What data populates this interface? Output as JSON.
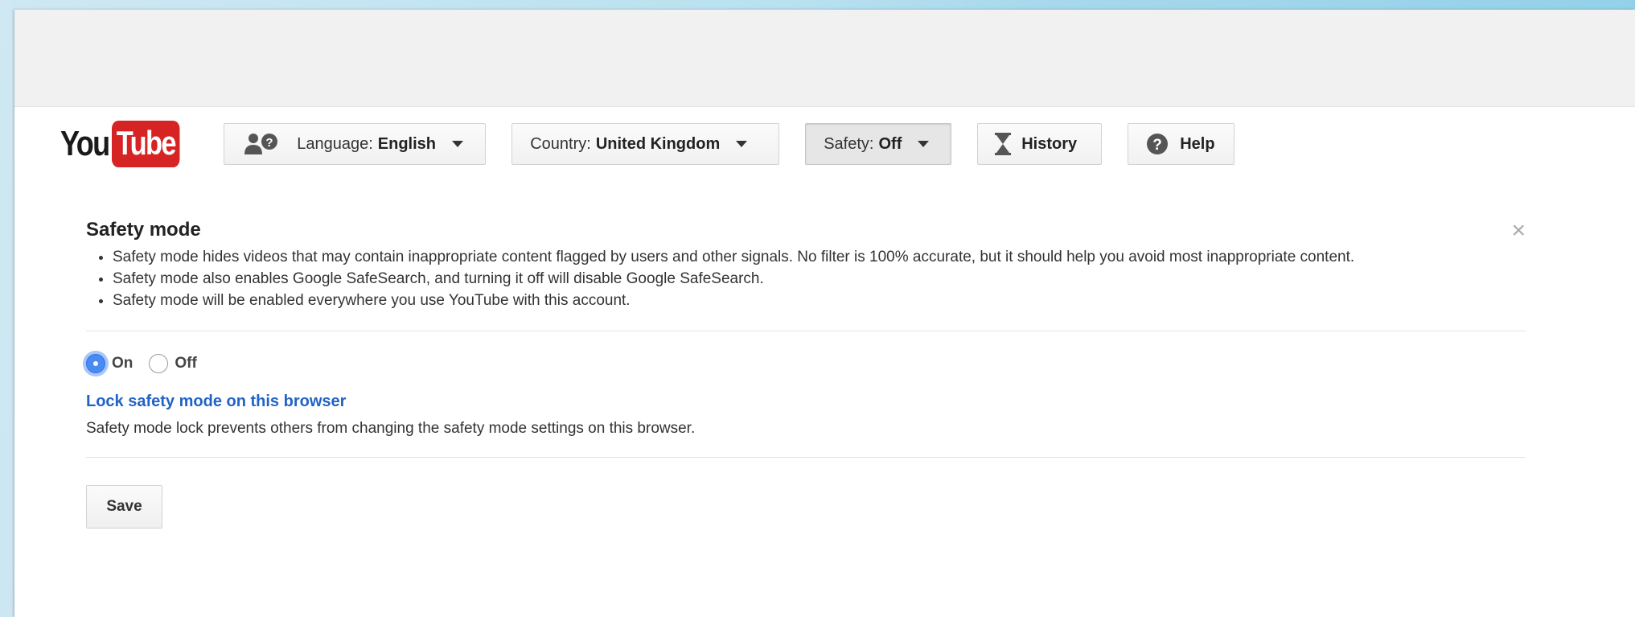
{
  "logo": {
    "you": "You",
    "tube": "Tube"
  },
  "toolbar": {
    "language": {
      "label": "Language:",
      "value": "English"
    },
    "country": {
      "label": "Country:",
      "value": "United Kingdom"
    },
    "safety": {
      "label": "Safety:",
      "value": "Off"
    },
    "history": {
      "label": "History"
    },
    "help": {
      "label": "Help"
    }
  },
  "panel": {
    "title": "Safety mode",
    "close": "×",
    "bullets": [
      "Safety mode hides videos that may contain inappropriate content flagged by users and other signals. No filter is 100% accurate, but it should help you avoid most inappropriate content.",
      "Safety mode also enables Google SafeSearch, and turning it off will disable Google SafeSearch.",
      "Safety mode will be enabled everywhere you use YouTube with this account."
    ],
    "options": {
      "on": "On",
      "off": "Off",
      "selected": "on"
    },
    "lock_link": "Lock safety mode on this browser",
    "lock_desc": "Safety mode lock prevents others from changing the safety mode settings on this browser.",
    "save": "Save"
  },
  "icons": {
    "language": "people-question-icon",
    "history": "hourglass-icon",
    "help": "question-circle-icon",
    "close": "close-icon"
  },
  "colors": {
    "accent_link": "#2163c7",
    "logo_red": "#d62424",
    "radio_selected": "#4a8af4"
  }
}
